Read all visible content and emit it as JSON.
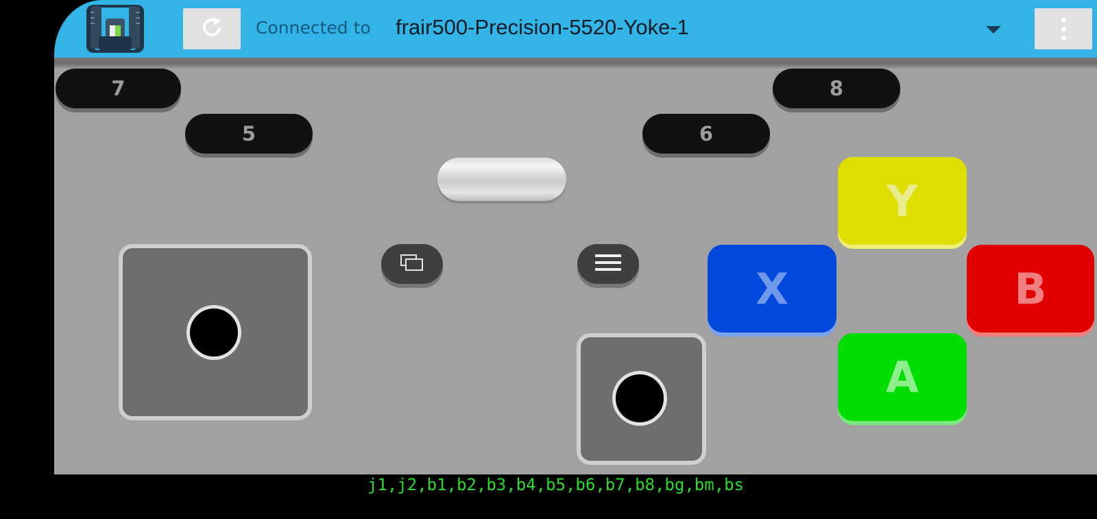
{
  "header": {
    "connected_label": "Connected to",
    "device_name": "frair500-Precision-5520-Yoke-1",
    "logo_icon": "robot-app-icon",
    "refresh_icon": "refresh-icon",
    "dropdown_icon": "triangle-down-icon",
    "menu_icon": "overflow-menu-icon"
  },
  "shoulder_buttons": {
    "b7": "7",
    "b8": "8",
    "b5": "5",
    "b6": "6"
  },
  "center_buttons": {
    "view_icon": "overlapping-windows-icon",
    "menu_icon": "hamburger-menu-icon"
  },
  "face_buttons": {
    "y": "Y",
    "x": "X",
    "b": "B",
    "a": "A"
  },
  "colors": {
    "topbar": "#33b4e6",
    "pad_background": "#a1a1a1",
    "y": "#dede00",
    "x": "#0049dc",
    "b": "#e00000",
    "a": "#00dd00",
    "debug_text": "#2adc2a"
  },
  "footer": {
    "debug_text": "j1,j2,b1,b2,b3,b4,b5,b6,b7,b8,bg,bm,bs"
  }
}
